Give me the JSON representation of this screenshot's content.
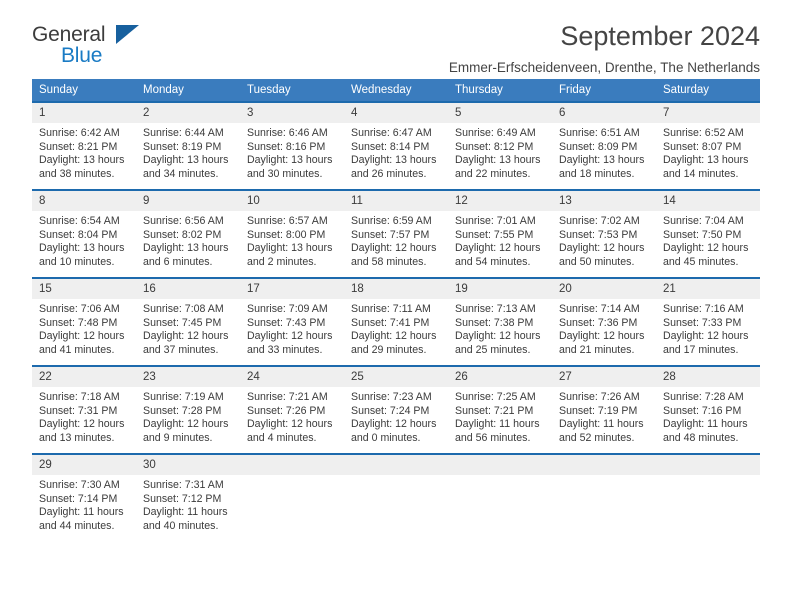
{
  "brand": {
    "name_part1": "General",
    "name_part2": "Blue",
    "logo_icon": "triangle-logo-icon"
  },
  "header": {
    "title": "September 2024",
    "subtitle": "Emmer-Erfscheidenveen, Drenthe, The Netherlands"
  },
  "theme": {
    "header_blue": "#3a7cbe",
    "cell_top_border_blue": "#1d6aad",
    "daynum_strip": "#efefef",
    "brand_blue": "#1a7bc4",
    "text": "#3b3b3b"
  },
  "calendar": {
    "weekday_headers": [
      "Sunday",
      "Monday",
      "Tuesday",
      "Wednesday",
      "Thursday",
      "Friday",
      "Saturday"
    ],
    "weeks": [
      [
        {
          "day": "1",
          "sunrise": "Sunrise: 6:42 AM",
          "sunset": "Sunset: 8:21 PM",
          "daylight1": "Daylight: 13 hours",
          "daylight2": "and 38 minutes."
        },
        {
          "day": "2",
          "sunrise": "Sunrise: 6:44 AM",
          "sunset": "Sunset: 8:19 PM",
          "daylight1": "Daylight: 13 hours",
          "daylight2": "and 34 minutes."
        },
        {
          "day": "3",
          "sunrise": "Sunrise: 6:46 AM",
          "sunset": "Sunset: 8:16 PM",
          "daylight1": "Daylight: 13 hours",
          "daylight2": "and 30 minutes."
        },
        {
          "day": "4",
          "sunrise": "Sunrise: 6:47 AM",
          "sunset": "Sunset: 8:14 PM",
          "daylight1": "Daylight: 13 hours",
          "daylight2": "and 26 minutes."
        },
        {
          "day": "5",
          "sunrise": "Sunrise: 6:49 AM",
          "sunset": "Sunset: 8:12 PM",
          "daylight1": "Daylight: 13 hours",
          "daylight2": "and 22 minutes."
        },
        {
          "day": "6",
          "sunrise": "Sunrise: 6:51 AM",
          "sunset": "Sunset: 8:09 PM",
          "daylight1": "Daylight: 13 hours",
          "daylight2": "and 18 minutes."
        },
        {
          "day": "7",
          "sunrise": "Sunrise: 6:52 AM",
          "sunset": "Sunset: 8:07 PM",
          "daylight1": "Daylight: 13 hours",
          "daylight2": "and 14 minutes."
        }
      ],
      [
        {
          "day": "8",
          "sunrise": "Sunrise: 6:54 AM",
          "sunset": "Sunset: 8:04 PM",
          "daylight1": "Daylight: 13 hours",
          "daylight2": "and 10 minutes."
        },
        {
          "day": "9",
          "sunrise": "Sunrise: 6:56 AM",
          "sunset": "Sunset: 8:02 PM",
          "daylight1": "Daylight: 13 hours",
          "daylight2": "and 6 minutes."
        },
        {
          "day": "10",
          "sunrise": "Sunrise: 6:57 AM",
          "sunset": "Sunset: 8:00 PM",
          "daylight1": "Daylight: 13 hours",
          "daylight2": "and 2 minutes."
        },
        {
          "day": "11",
          "sunrise": "Sunrise: 6:59 AM",
          "sunset": "Sunset: 7:57 PM",
          "daylight1": "Daylight: 12 hours",
          "daylight2": "and 58 minutes."
        },
        {
          "day": "12",
          "sunrise": "Sunrise: 7:01 AM",
          "sunset": "Sunset: 7:55 PM",
          "daylight1": "Daylight: 12 hours",
          "daylight2": "and 54 minutes."
        },
        {
          "day": "13",
          "sunrise": "Sunrise: 7:02 AM",
          "sunset": "Sunset: 7:53 PM",
          "daylight1": "Daylight: 12 hours",
          "daylight2": "and 50 minutes."
        },
        {
          "day": "14",
          "sunrise": "Sunrise: 7:04 AM",
          "sunset": "Sunset: 7:50 PM",
          "daylight1": "Daylight: 12 hours",
          "daylight2": "and 45 minutes."
        }
      ],
      [
        {
          "day": "15",
          "sunrise": "Sunrise: 7:06 AM",
          "sunset": "Sunset: 7:48 PM",
          "daylight1": "Daylight: 12 hours",
          "daylight2": "and 41 minutes."
        },
        {
          "day": "16",
          "sunrise": "Sunrise: 7:08 AM",
          "sunset": "Sunset: 7:45 PM",
          "daylight1": "Daylight: 12 hours",
          "daylight2": "and 37 minutes."
        },
        {
          "day": "17",
          "sunrise": "Sunrise: 7:09 AM",
          "sunset": "Sunset: 7:43 PM",
          "daylight1": "Daylight: 12 hours",
          "daylight2": "and 33 minutes."
        },
        {
          "day": "18",
          "sunrise": "Sunrise: 7:11 AM",
          "sunset": "Sunset: 7:41 PM",
          "daylight1": "Daylight: 12 hours",
          "daylight2": "and 29 minutes."
        },
        {
          "day": "19",
          "sunrise": "Sunrise: 7:13 AM",
          "sunset": "Sunset: 7:38 PM",
          "daylight1": "Daylight: 12 hours",
          "daylight2": "and 25 minutes."
        },
        {
          "day": "20",
          "sunrise": "Sunrise: 7:14 AM",
          "sunset": "Sunset: 7:36 PM",
          "daylight1": "Daylight: 12 hours",
          "daylight2": "and 21 minutes."
        },
        {
          "day": "21",
          "sunrise": "Sunrise: 7:16 AM",
          "sunset": "Sunset: 7:33 PM",
          "daylight1": "Daylight: 12 hours",
          "daylight2": "and 17 minutes."
        }
      ],
      [
        {
          "day": "22",
          "sunrise": "Sunrise: 7:18 AM",
          "sunset": "Sunset: 7:31 PM",
          "daylight1": "Daylight: 12 hours",
          "daylight2": "and 13 minutes."
        },
        {
          "day": "23",
          "sunrise": "Sunrise: 7:19 AM",
          "sunset": "Sunset: 7:28 PM",
          "daylight1": "Daylight: 12 hours",
          "daylight2": "and 9 minutes."
        },
        {
          "day": "24",
          "sunrise": "Sunrise: 7:21 AM",
          "sunset": "Sunset: 7:26 PM",
          "daylight1": "Daylight: 12 hours",
          "daylight2": "and 4 minutes."
        },
        {
          "day": "25",
          "sunrise": "Sunrise: 7:23 AM",
          "sunset": "Sunset: 7:24 PM",
          "daylight1": "Daylight: 12 hours",
          "daylight2": "and 0 minutes."
        },
        {
          "day": "26",
          "sunrise": "Sunrise: 7:25 AM",
          "sunset": "Sunset: 7:21 PM",
          "daylight1": "Daylight: 11 hours",
          "daylight2": "and 56 minutes."
        },
        {
          "day": "27",
          "sunrise": "Sunrise: 7:26 AM",
          "sunset": "Sunset: 7:19 PM",
          "daylight1": "Daylight: 11 hours",
          "daylight2": "and 52 minutes."
        },
        {
          "day": "28",
          "sunrise": "Sunrise: 7:28 AM",
          "sunset": "Sunset: 7:16 PM",
          "daylight1": "Daylight: 11 hours",
          "daylight2": "and 48 minutes."
        }
      ],
      [
        {
          "day": "29",
          "sunrise": "Sunrise: 7:30 AM",
          "sunset": "Sunset: 7:14 PM",
          "daylight1": "Daylight: 11 hours",
          "daylight2": "and 44 minutes."
        },
        {
          "day": "30",
          "sunrise": "Sunrise: 7:31 AM",
          "sunset": "Sunset: 7:12 PM",
          "daylight1": "Daylight: 11 hours",
          "daylight2": "and 40 minutes."
        },
        {
          "day": "",
          "sunrise": "",
          "sunset": "",
          "daylight1": "",
          "daylight2": ""
        },
        {
          "day": "",
          "sunrise": "",
          "sunset": "",
          "daylight1": "",
          "daylight2": ""
        },
        {
          "day": "",
          "sunrise": "",
          "sunset": "",
          "daylight1": "",
          "daylight2": ""
        },
        {
          "day": "",
          "sunrise": "",
          "sunset": "",
          "daylight1": "",
          "daylight2": ""
        },
        {
          "day": "",
          "sunrise": "",
          "sunset": "",
          "daylight1": "",
          "daylight2": ""
        }
      ]
    ]
  }
}
